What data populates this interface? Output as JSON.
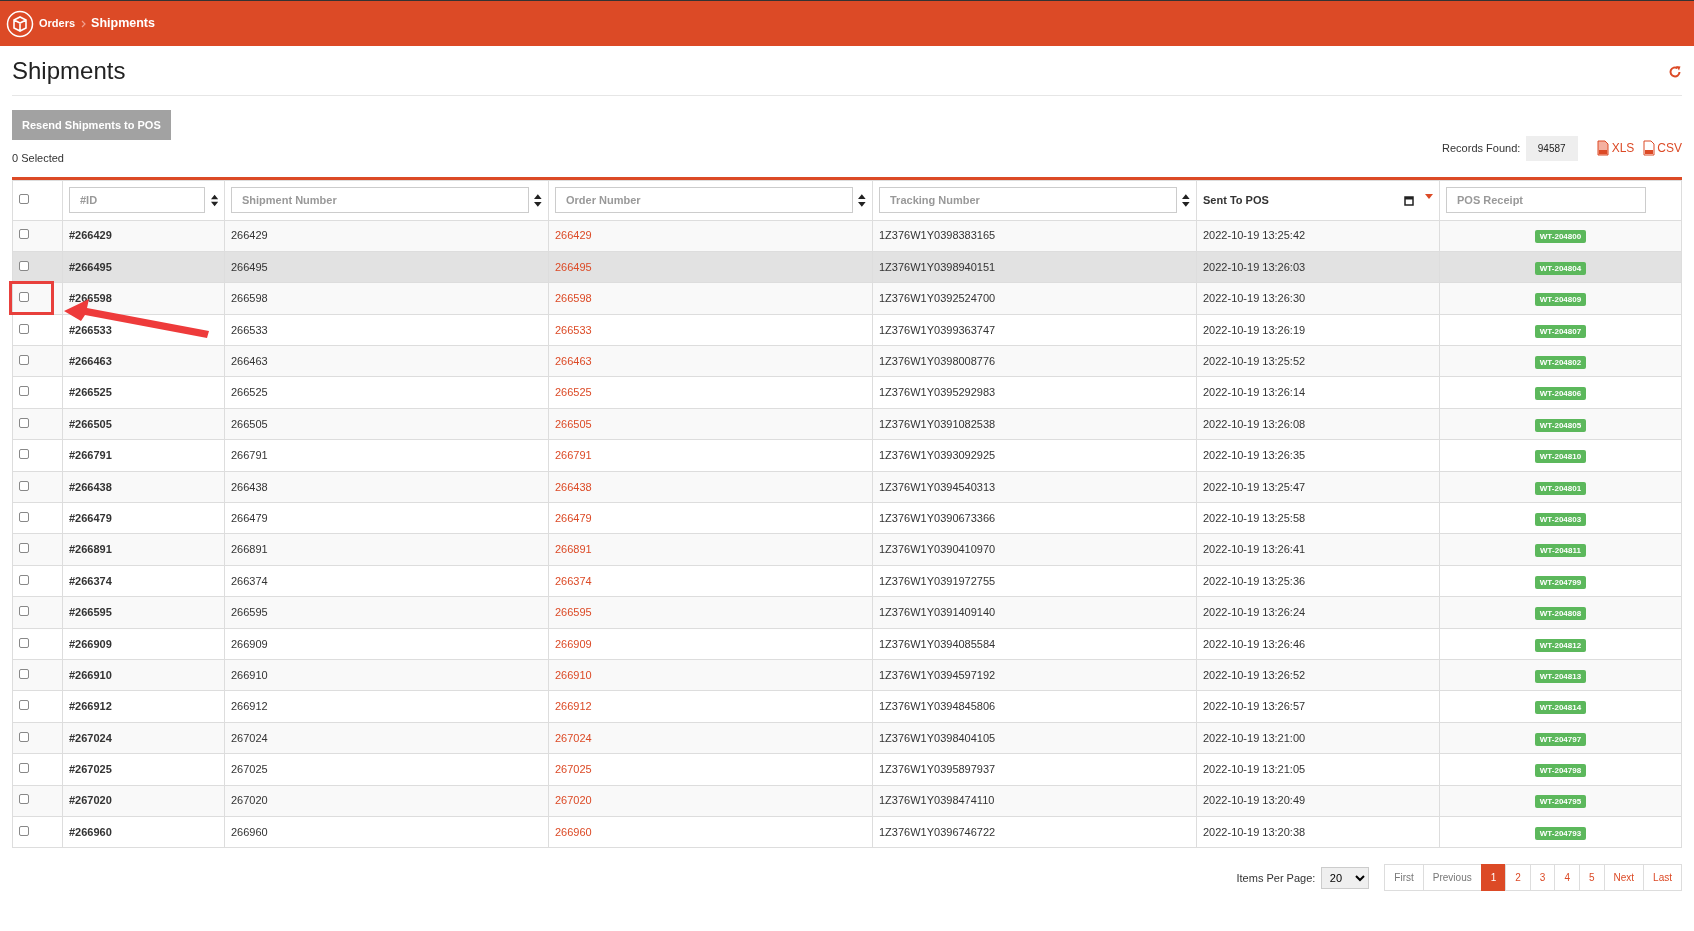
{
  "breadcrumb": [
    {
      "label": "Orders",
      "current": false
    },
    {
      "label": "Shipments",
      "current": true
    }
  ],
  "title": "Shipments",
  "resend_button": {
    "label": "Resend Shipments to POS",
    "disabled": true
  },
  "selected_count": "0 Selected",
  "records": {
    "label": "Records Found:",
    "value": "94587"
  },
  "exports": [
    {
      "label": "XLS",
      "kind": "xls"
    },
    {
      "label": "CSV",
      "kind": "csv"
    }
  ],
  "columns": [
    {
      "kind": "check",
      "checked": false
    },
    {
      "kind": "filter",
      "placeholder": "#ID",
      "sortable": true
    },
    {
      "kind": "filter",
      "placeholder": "Shipment Number",
      "sortable": true
    },
    {
      "kind": "filter",
      "placeholder": "Order Number",
      "sortable": true
    },
    {
      "kind": "filter",
      "placeholder": "Tracking Number",
      "sortable": true
    },
    {
      "kind": "date",
      "label": "Sent To POS",
      "sorted": true
    },
    {
      "kind": "filter",
      "placeholder": "POS Receipt",
      "sortable": false
    }
  ],
  "rows": [
    {
      "id": "#266429",
      "shipment": "266429",
      "order": "266429",
      "tracking": "1Z376W1Y0398383165",
      "sent": "2022-10-19 13:25:42",
      "receipt": "WT-204800",
      "checked": false,
      "hovered": false,
      "annotated": false
    },
    {
      "id": "#266495",
      "shipment": "266495",
      "order": "266495",
      "tracking": "1Z376W1Y0398940151",
      "sent": "2022-10-19 13:26:03",
      "receipt": "WT-204804",
      "checked": false,
      "hovered": true,
      "annotated": false
    },
    {
      "id": "#266598",
      "shipment": "266598",
      "order": "266598",
      "tracking": "1Z376W1Y0392524700",
      "sent": "2022-10-19 13:26:30",
      "receipt": "WT-204809",
      "checked": false,
      "hovered": false,
      "annotated": true
    },
    {
      "id": "#266533",
      "shipment": "266533",
      "order": "266533",
      "tracking": "1Z376W1Y0399363747",
      "sent": "2022-10-19 13:26:19",
      "receipt": "WT-204807",
      "checked": false,
      "hovered": false,
      "annotated": false
    },
    {
      "id": "#266463",
      "shipment": "266463",
      "order": "266463",
      "tracking": "1Z376W1Y0398008776",
      "sent": "2022-10-19 13:25:52",
      "receipt": "WT-204802",
      "checked": false,
      "hovered": false,
      "annotated": false
    },
    {
      "id": "#266525",
      "shipment": "266525",
      "order": "266525",
      "tracking": "1Z376W1Y0395292983",
      "sent": "2022-10-19 13:26:14",
      "receipt": "WT-204806",
      "checked": false,
      "hovered": false,
      "annotated": false
    },
    {
      "id": "#266505",
      "shipment": "266505",
      "order": "266505",
      "tracking": "1Z376W1Y0391082538",
      "sent": "2022-10-19 13:26:08",
      "receipt": "WT-204805",
      "checked": false,
      "hovered": false,
      "annotated": false
    },
    {
      "id": "#266791",
      "shipment": "266791",
      "order": "266791",
      "tracking": "1Z376W1Y0393092925",
      "sent": "2022-10-19 13:26:35",
      "receipt": "WT-204810",
      "checked": false,
      "hovered": false,
      "annotated": false
    },
    {
      "id": "#266438",
      "shipment": "266438",
      "order": "266438",
      "tracking": "1Z376W1Y0394540313",
      "sent": "2022-10-19 13:25:47",
      "receipt": "WT-204801",
      "checked": false,
      "hovered": false,
      "annotated": false
    },
    {
      "id": "#266479",
      "shipment": "266479",
      "order": "266479",
      "tracking": "1Z376W1Y0390673366",
      "sent": "2022-10-19 13:25:58",
      "receipt": "WT-204803",
      "checked": false,
      "hovered": false,
      "annotated": false
    },
    {
      "id": "#266891",
      "shipment": "266891",
      "order": "266891",
      "tracking": "1Z376W1Y0390410970",
      "sent": "2022-10-19 13:26:41",
      "receipt": "WT-204811",
      "checked": false,
      "hovered": false,
      "annotated": false
    },
    {
      "id": "#266374",
      "shipment": "266374",
      "order": "266374",
      "tracking": "1Z376W1Y0391972755",
      "sent": "2022-10-19 13:25:36",
      "receipt": "WT-204799",
      "checked": false,
      "hovered": false,
      "annotated": false
    },
    {
      "id": "#266595",
      "shipment": "266595",
      "order": "266595",
      "tracking": "1Z376W1Y0391409140",
      "sent": "2022-10-19 13:26:24",
      "receipt": "WT-204808",
      "checked": false,
      "hovered": false,
      "annotated": false
    },
    {
      "id": "#266909",
      "shipment": "266909",
      "order": "266909",
      "tracking": "1Z376W1Y0394085584",
      "sent": "2022-10-19 13:26:46",
      "receipt": "WT-204812",
      "checked": false,
      "hovered": false,
      "annotated": false
    },
    {
      "id": "#266910",
      "shipment": "266910",
      "order": "266910",
      "tracking": "1Z376W1Y0394597192",
      "sent": "2022-10-19 13:26:52",
      "receipt": "WT-204813",
      "checked": false,
      "hovered": false,
      "annotated": false
    },
    {
      "id": "#266912",
      "shipment": "266912",
      "order": "266912",
      "tracking": "1Z376W1Y0394845806",
      "sent": "2022-10-19 13:26:57",
      "receipt": "WT-204814",
      "checked": false,
      "hovered": false,
      "annotated": false
    },
    {
      "id": "#267024",
      "shipment": "267024",
      "order": "267024",
      "tracking": "1Z376W1Y0398404105",
      "sent": "2022-10-19 13:21:00",
      "receipt": "WT-204797",
      "checked": false,
      "hovered": false,
      "annotated": false
    },
    {
      "id": "#267025",
      "shipment": "267025",
      "order": "267025",
      "tracking": "1Z376W1Y0395897937",
      "sent": "2022-10-19 13:21:05",
      "receipt": "WT-204798",
      "checked": false,
      "hovered": false,
      "annotated": false
    },
    {
      "id": "#267020",
      "shipment": "267020",
      "order": "267020",
      "tracking": "1Z376W1Y0398474110",
      "sent": "2022-10-19 13:20:49",
      "receipt": "WT-204795",
      "checked": false,
      "hovered": false,
      "annotated": false
    },
    {
      "id": "#266960",
      "shipment": "266960",
      "order": "266960",
      "tracking": "1Z376W1Y0396746722",
      "sent": "2022-10-19 13:20:38",
      "receipt": "WT-204793",
      "checked": false,
      "hovered": false,
      "annotated": false
    }
  ],
  "pagination": {
    "per_page_label": "Items Per Page:",
    "per_page": "20",
    "pages": [
      {
        "label": "First",
        "enabled": false,
        "selected": false
      },
      {
        "label": "Previous",
        "enabled": false,
        "selected": false
      },
      {
        "label": "1",
        "enabled": true,
        "selected": true
      },
      {
        "label": "2",
        "enabled": true,
        "selected": false
      },
      {
        "label": "3",
        "enabled": true,
        "selected": false
      },
      {
        "label": "4",
        "enabled": true,
        "selected": false
      },
      {
        "label": "5",
        "enabled": true,
        "selected": false
      },
      {
        "label": "Next",
        "enabled": true,
        "selected": false
      },
      {
        "label": "Last",
        "enabled": true,
        "selected": false
      }
    ]
  }
}
